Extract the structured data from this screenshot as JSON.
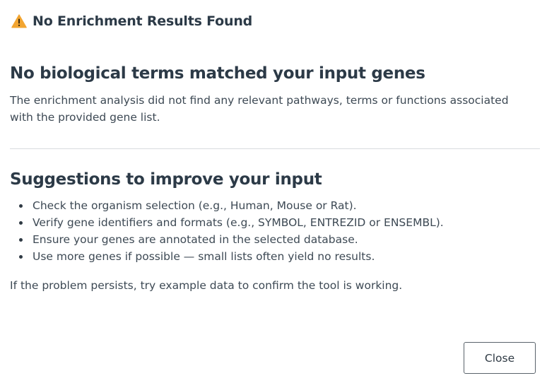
{
  "header": {
    "icon": "warning-triangle-icon",
    "icon_color": "#f2a531",
    "title": "No Enrichment Results Found"
  },
  "section1": {
    "title": "No biological terms matched your input genes",
    "description": "The enrichment analysis did not find any relevant pathways, terms or functions associated with the provided gene list."
  },
  "section2": {
    "title": "Suggestions to improve your input",
    "items": [
      "Check the organism selection (e.g., Human, Mouse or Rat).",
      "Verify gene identifiers and formats (e.g., SYMBOL, ENTREZID or ENSEMBL).",
      "Ensure your genes are annotated in the selected database.",
      "Use more genes if possible — small lists often yield no results."
    ]
  },
  "footer_note": "If the problem persists, try example data to confirm the tool is working.",
  "actions": {
    "close_label": "Close"
  }
}
